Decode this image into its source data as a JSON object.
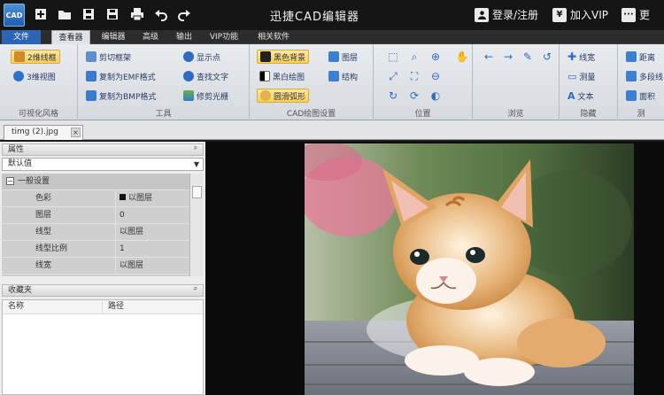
{
  "app": {
    "icon_text": "CAD",
    "title": "迅捷CAD编辑器",
    "login": "登录/注册",
    "vip": "加入VIP",
    "vip_badge": "¥",
    "more": "···",
    "extra": "更"
  },
  "quick_access": [
    "new-icon",
    "open-icon",
    "save-icon",
    "save-as-icon",
    "print-icon",
    "undo-icon",
    "redo-icon"
  ],
  "menu": {
    "file": "文件",
    "tabs": [
      "查看器",
      "编辑器",
      "高级",
      "输出",
      "VIP功能",
      "相关软件"
    ],
    "active": "查看器"
  },
  "ribbon": {
    "vis": {
      "items": [
        "2维线框",
        "3维视图"
      ],
      "label": "可视化风格"
    },
    "tools": {
      "items": [
        "剪切框架",
        "复制为EMF格式",
        "复制为BMP格式",
        "显示点",
        "查找文字",
        "修剪光栅"
      ],
      "label": "工具"
    },
    "cad": {
      "items": [
        "黑色背景",
        "黑白绘图",
        "圆滑弧形",
        "图层",
        "结构"
      ],
      "label": "CAD绘图设置"
    },
    "position": {
      "label": "位置"
    },
    "browse": {
      "label": "浏览"
    },
    "hide": {
      "items": [
        "线宽",
        "测量",
        "文本"
      ],
      "label": "隐藏"
    },
    "measure": {
      "items": [
        "距离",
        "多段线",
        "面积"
      ],
      "label": "测"
    }
  },
  "document": {
    "tab": "timg (2).jpg",
    "close": "×"
  },
  "properties": {
    "title": "属性",
    "pin": "ᵖ",
    "selector": "默认值",
    "category": "一般设置",
    "rows": [
      {
        "name": "色彩",
        "value": "以图层"
      },
      {
        "name": "图层",
        "value": "0"
      },
      {
        "name": "线型",
        "value": "以图层"
      },
      {
        "name": "线型比例",
        "value": "1"
      },
      {
        "name": "线宽",
        "value": "以图层"
      }
    ]
  },
  "favorites": {
    "title": "收藏夹",
    "pin": "ᵖ",
    "columns": [
      "名称",
      "路径"
    ]
  },
  "colors": {
    "title_bg": "#151515",
    "file_tab": "#2d64b3",
    "ribbon_bg": "#dfe3e8",
    "highlight": "#f7cf5c",
    "canvas_bg": "#0b0b0b"
  }
}
